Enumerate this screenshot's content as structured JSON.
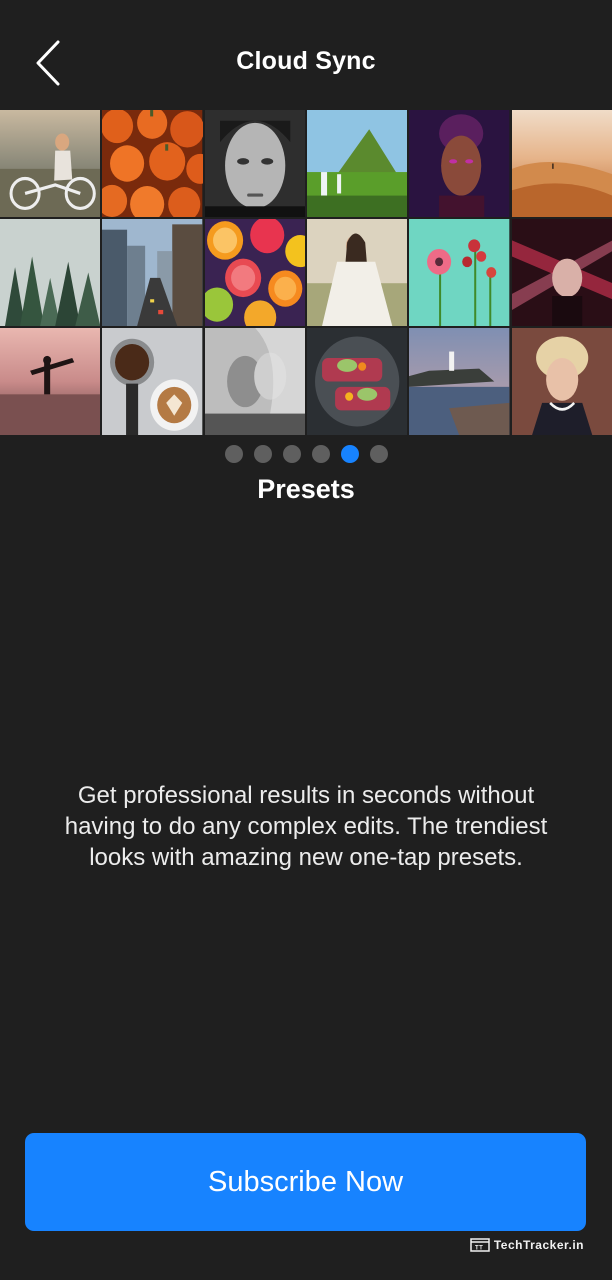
{
  "header": {
    "title": "Cloud Sync",
    "back_icon": "chevron-left-icon"
  },
  "gallery": {
    "tiles": [
      "cyclist-photo",
      "pumpkins-photo",
      "bw-portrait-photo",
      "waterfall-mountain-photo",
      "purple-portrait-photo",
      "desert-dunes-photo",
      "misty-forest-photo",
      "city-street-photo",
      "citrus-slices-photo",
      "bride-photo",
      "flowers-photo",
      "red-light-portrait-photo",
      "surfer-sunset-photo",
      "coffee-photo",
      "bw-couple-photo",
      "avocado-toast-photo",
      "lighthouse-photo",
      "vintage-portrait-photo"
    ]
  },
  "pager": {
    "count": 6,
    "active_index": 4
  },
  "feature": {
    "heading": "Presets",
    "description": "Get professional results in seconds without having to do any complex edits. The trendiest looks with amazing new one-tap presets."
  },
  "cta": {
    "label": "Subscribe Now"
  },
  "watermark": {
    "text": "TechTracker.in"
  },
  "colors": {
    "background": "#1f1f1f",
    "accent": "#1783ff",
    "dot_inactive": "#5f5f5f"
  }
}
